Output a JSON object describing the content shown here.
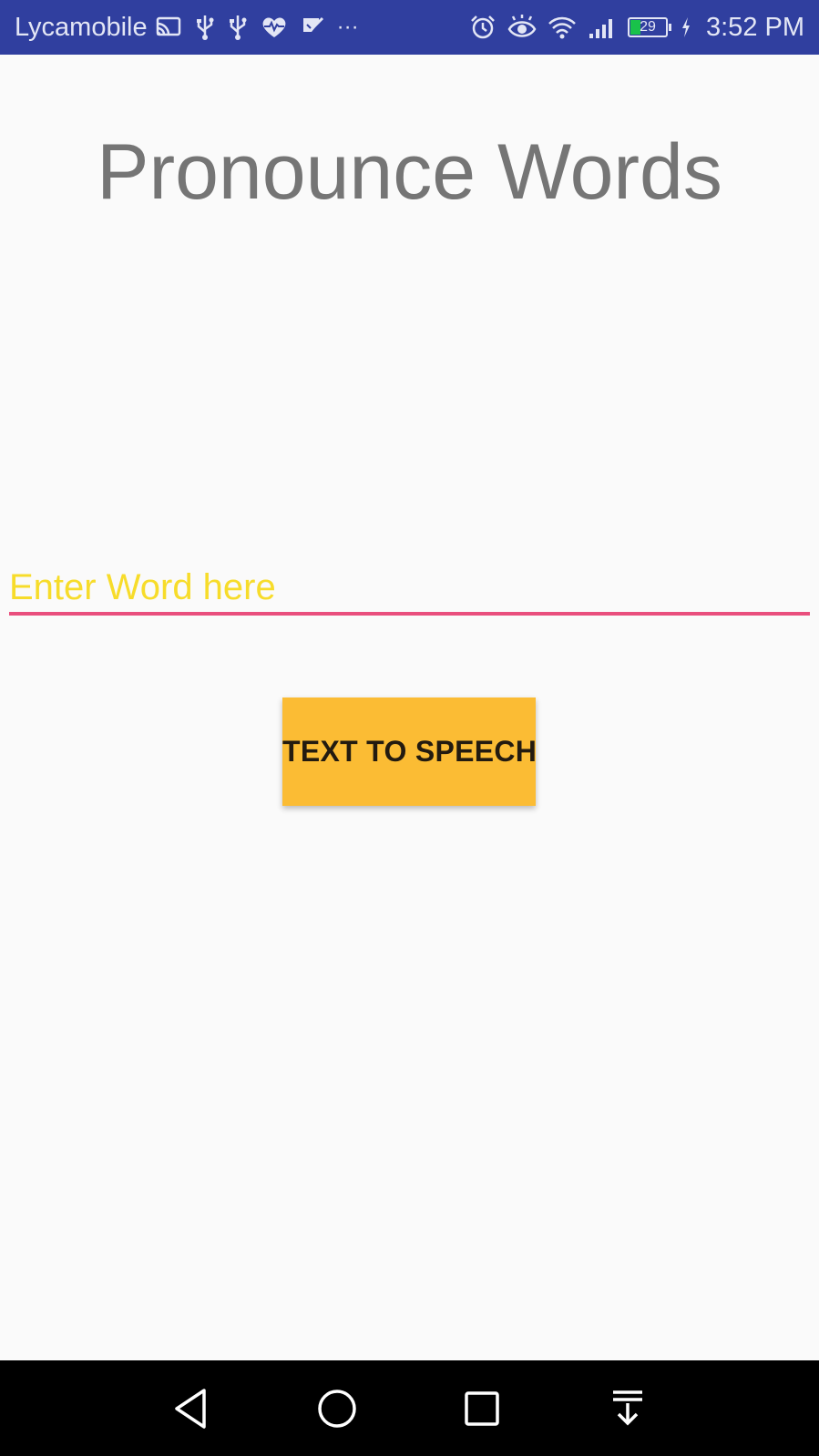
{
  "status_bar": {
    "carrier": "Lycamobile",
    "time": "3:52 PM",
    "battery_level": "29",
    "battery_fraction": 0.29,
    "overflow_glyph": "···",
    "background_color": "#303f9f",
    "icons_left": [
      "cast-icon",
      "usb-icon",
      "usb-icon",
      "heart-rate-icon",
      "task-check-icon",
      "more-notifications-icon"
    ],
    "icons_right": [
      "alarm-icon",
      "eye-icon",
      "wifi-icon",
      "signal-icon",
      "battery-icon",
      "charging-icon"
    ]
  },
  "main": {
    "title": "Pronounce Words",
    "title_color": "#757575",
    "input": {
      "value": "",
      "placeholder": "Enter Word here",
      "placeholder_color": "#f7dc2a",
      "underline_color": "#e94f7d"
    },
    "button": {
      "label": "TEXT TO SPEECH",
      "background_color": "#fbbc34"
    }
  },
  "nav_bar": {
    "buttons": [
      "back-icon",
      "home-icon",
      "recents-icon",
      "notification-pulldown-icon"
    ],
    "background_color": "#000000"
  }
}
